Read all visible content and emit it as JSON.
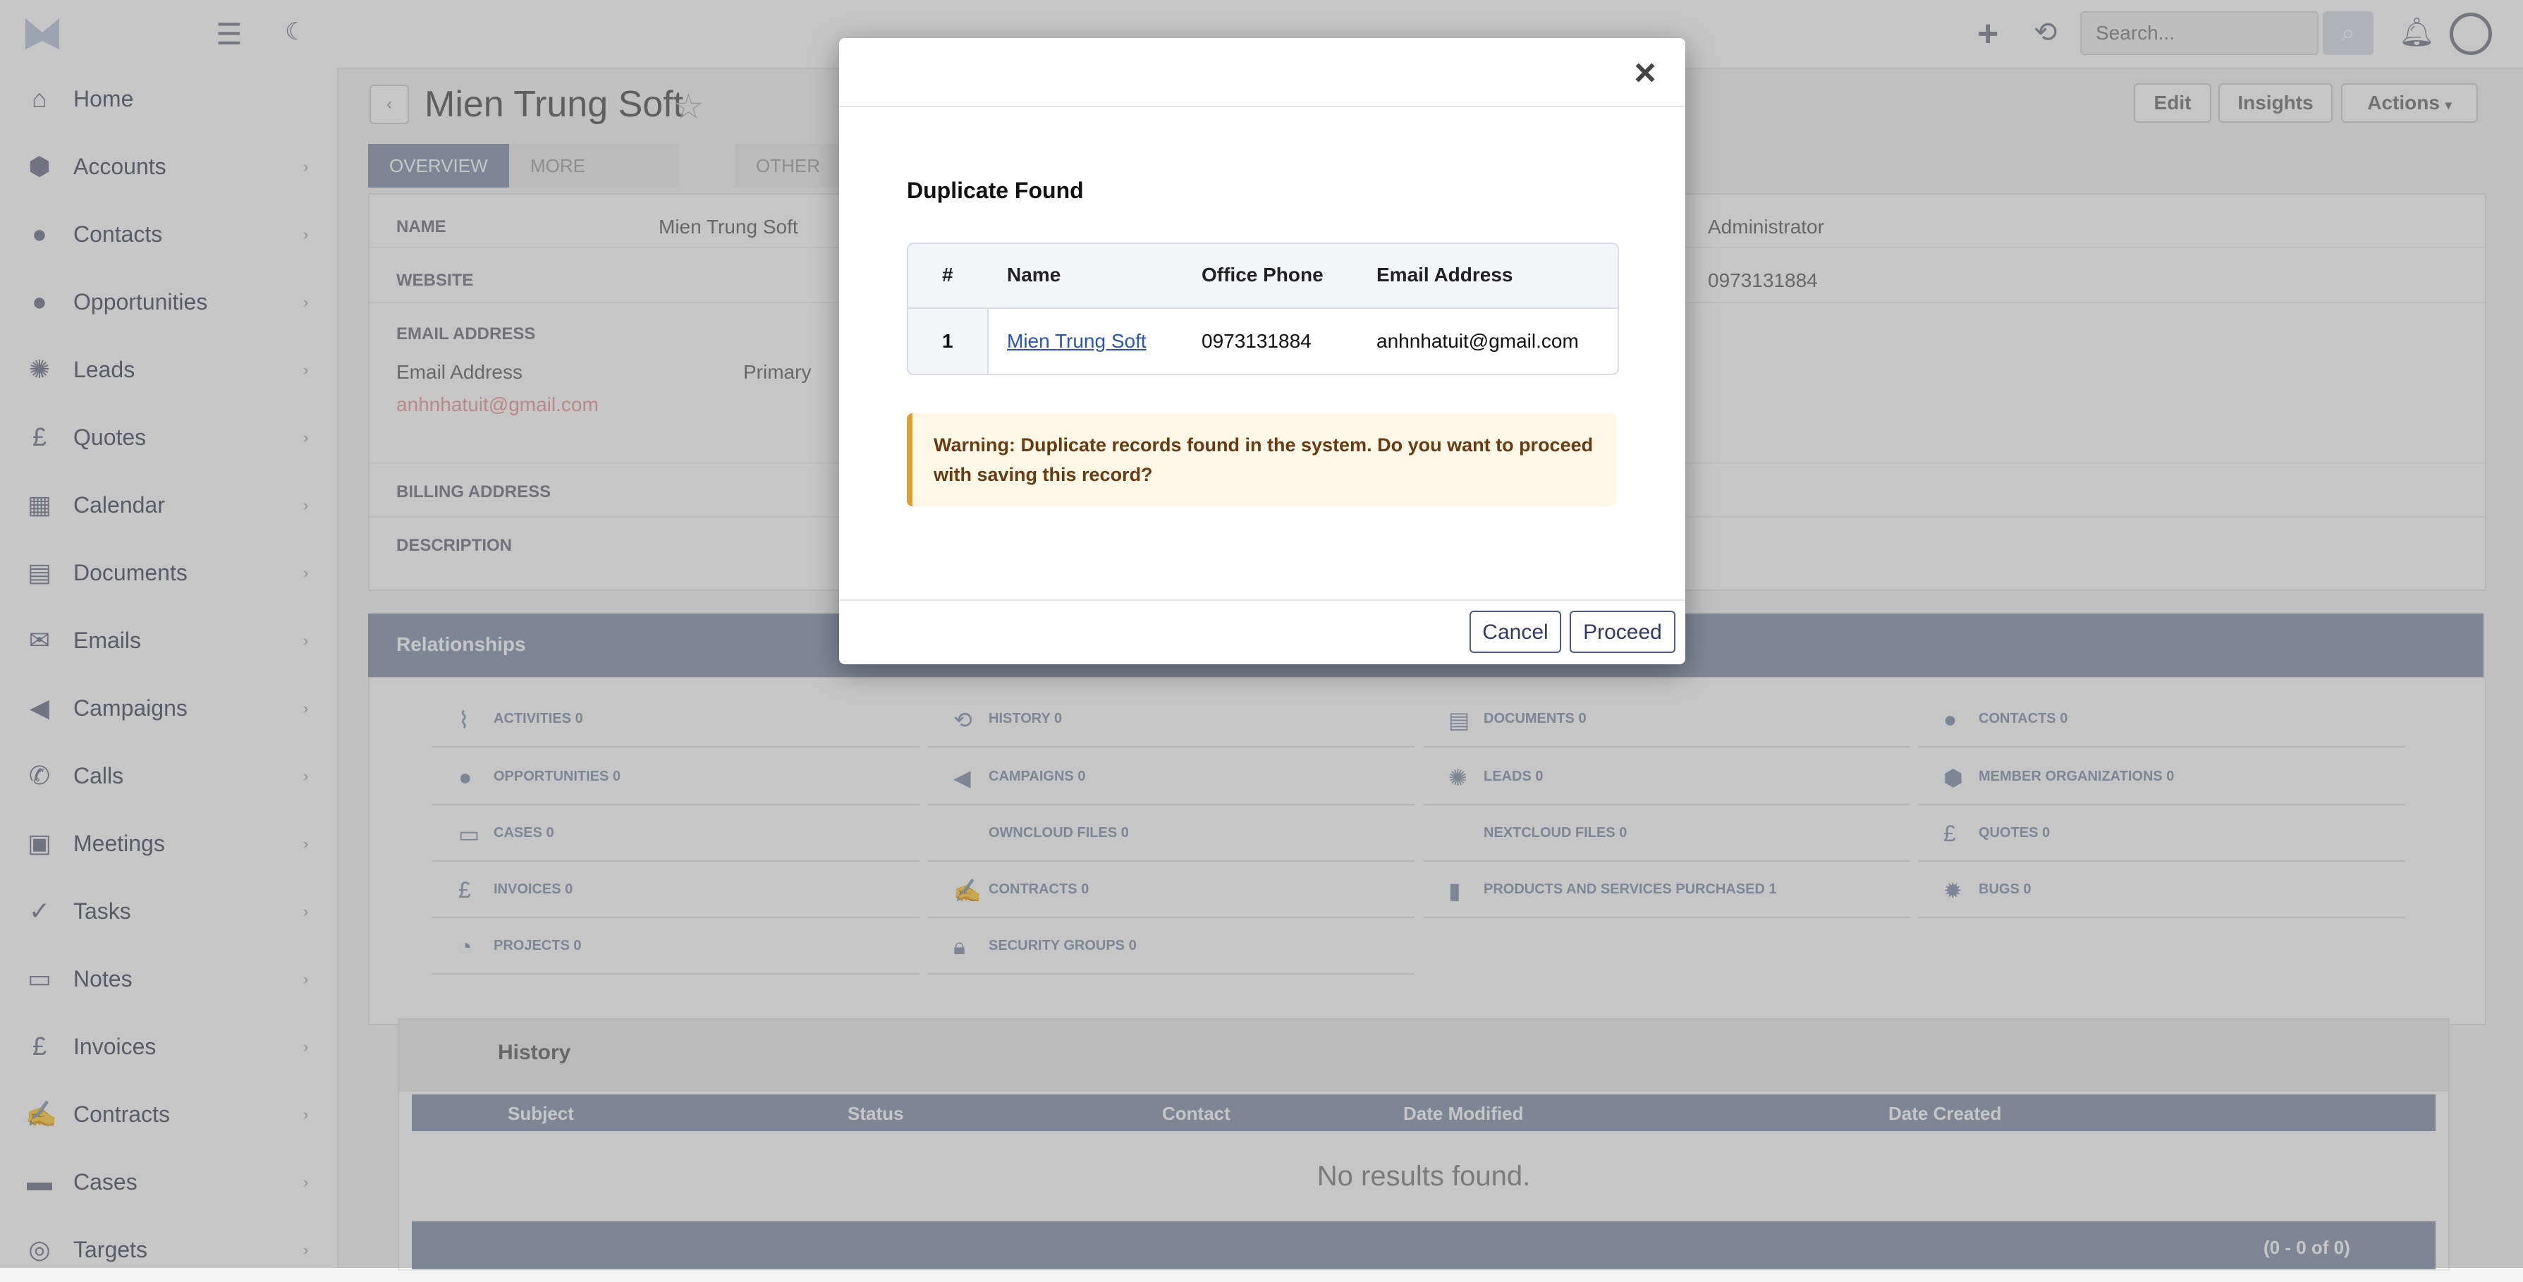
{
  "topbar": {
    "logo_text": "",
    "search_placeholder": "Search..."
  },
  "sidebar": {
    "items": [
      {
        "label": "Home",
        "icon": "home-icon"
      },
      {
        "label": "Accounts",
        "icon": "accounts-icon"
      },
      {
        "label": "Contacts",
        "icon": "contacts-icon"
      },
      {
        "label": "Opportunities",
        "icon": "opportunities-icon"
      },
      {
        "label": "Leads",
        "icon": "leads-icon"
      },
      {
        "label": "Quotes",
        "icon": "quotes-icon"
      },
      {
        "label": "Calendar",
        "icon": "calendar-icon"
      },
      {
        "label": "Documents",
        "icon": "documents-icon"
      },
      {
        "label": "Emails",
        "icon": "emails-icon"
      },
      {
        "label": "Campaigns",
        "icon": "campaigns-icon"
      },
      {
        "label": "Calls",
        "icon": "calls-icon"
      },
      {
        "label": "Meetings",
        "icon": "meetings-icon"
      },
      {
        "label": "Tasks",
        "icon": "tasks-icon"
      },
      {
        "label": "Notes",
        "icon": "notes-icon"
      },
      {
        "label": "Invoices",
        "icon": "invoices-icon"
      },
      {
        "label": "Contracts",
        "icon": "contracts-icon"
      },
      {
        "label": "Cases",
        "icon": "cases-icon"
      },
      {
        "label": "Targets",
        "icon": "targets-icon"
      }
    ]
  },
  "record": {
    "title": "Mien Trung Soft",
    "buttons": {
      "edit": "Edit",
      "insights": "Insights",
      "actions": "Actions"
    },
    "tabs": {
      "overview": "OVERVIEW",
      "more_info": "MORE INFORMATION",
      "other": "OTHER"
    },
    "fields": {
      "name_label": "NAME",
      "name_value": "Mien Trung Soft",
      "assigned_value": "Administrator",
      "website_label": "WEBSITE",
      "phone_value": "0973131884",
      "email_label": "EMAIL ADDRESS",
      "email_sub_label": "Email Address",
      "email_primary": "Primary",
      "email_value": "anhnhatuit@gmail.com",
      "billing_label": "BILLING ADDRESS",
      "description_label": "DESCRIPTION"
    }
  },
  "relationships": {
    "title": "Relationships",
    "items": [
      {
        "label": "ACTIVITIES",
        "count": "0"
      },
      {
        "label": "HISTORY",
        "count": "0"
      },
      {
        "label": "DOCUMENTS",
        "count": "0"
      },
      {
        "label": "CONTACTS",
        "count": "0"
      },
      {
        "label": "OPPORTUNITIES",
        "count": "0"
      },
      {
        "label": "CAMPAIGNS",
        "count": "0"
      },
      {
        "label": "LEADS",
        "count": "0"
      },
      {
        "label": "MEMBER ORGANIZATIONS",
        "count": "0"
      },
      {
        "label": "CASES",
        "count": "0"
      },
      {
        "label": "OWNCLOUD FILES",
        "count": "0"
      },
      {
        "label": "NEXTCLOUD FILES",
        "count": "0"
      },
      {
        "label": "QUOTES",
        "count": "0"
      },
      {
        "label": "INVOICES",
        "count": "0"
      },
      {
        "label": "CONTRACTS",
        "count": "0"
      },
      {
        "label": "PRODUCTS AND SERVICES PURCHASED",
        "count": "1"
      },
      {
        "label": "BUGS",
        "count": "0"
      },
      {
        "label": "PROJECTS",
        "count": "0"
      },
      {
        "label": "SECURITY GROUPS",
        "count": "0"
      }
    ]
  },
  "history": {
    "title": "History",
    "columns": [
      "Subject",
      "Status",
      "Contact",
      "Date Modified",
      "Date Created"
    ],
    "empty": "No results found.",
    "pager": "(0 - 0 of 0)"
  },
  "modal": {
    "title": "Duplicate Found",
    "headers": {
      "num": "#",
      "name": "Name",
      "phone": "Office Phone",
      "email": "Email Address"
    },
    "rows": [
      {
        "num": "1",
        "name": "Mien Trung Soft",
        "phone": "0973131884",
        "email": "anhnhatuit@gmail.com"
      }
    ],
    "warning": "Warning: Duplicate records found in the system. Do you want to proceed with saving this record?",
    "cancel_label": "Cancel",
    "proceed_label": "Proceed"
  }
}
